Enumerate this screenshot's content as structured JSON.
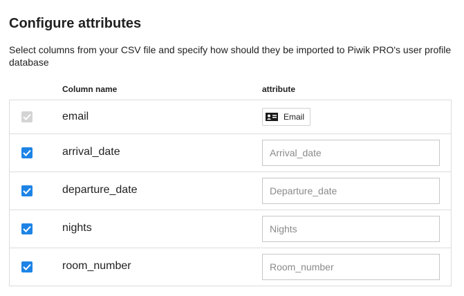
{
  "page": {
    "title": "Configure attributes",
    "description": "Select columns from your CSV file and specify how should they be imported to Piwik PRO's user profile database"
  },
  "table": {
    "headers": {
      "column_name": "Column name",
      "attribute": "attribute"
    },
    "rows": [
      {
        "column": "email",
        "checked": true,
        "disabled": true,
        "attribute_label": "Email",
        "attribute_icon": "id-card-icon"
      },
      {
        "column": "arrival_date",
        "checked": true,
        "placeholder": "Arrival_date",
        "value": ""
      },
      {
        "column": "departure_date",
        "checked": true,
        "placeholder": "Departure_date",
        "value": ""
      },
      {
        "column": "nights",
        "checked": true,
        "placeholder": "Nights",
        "value": ""
      },
      {
        "column": "room_number",
        "checked": true,
        "placeholder": "Room_number",
        "value": ""
      }
    ]
  },
  "colors": {
    "checkbox_checked": "#1d84e6",
    "checkbox_disabled": "#d4d4d4",
    "border": "#dcdcdc"
  }
}
